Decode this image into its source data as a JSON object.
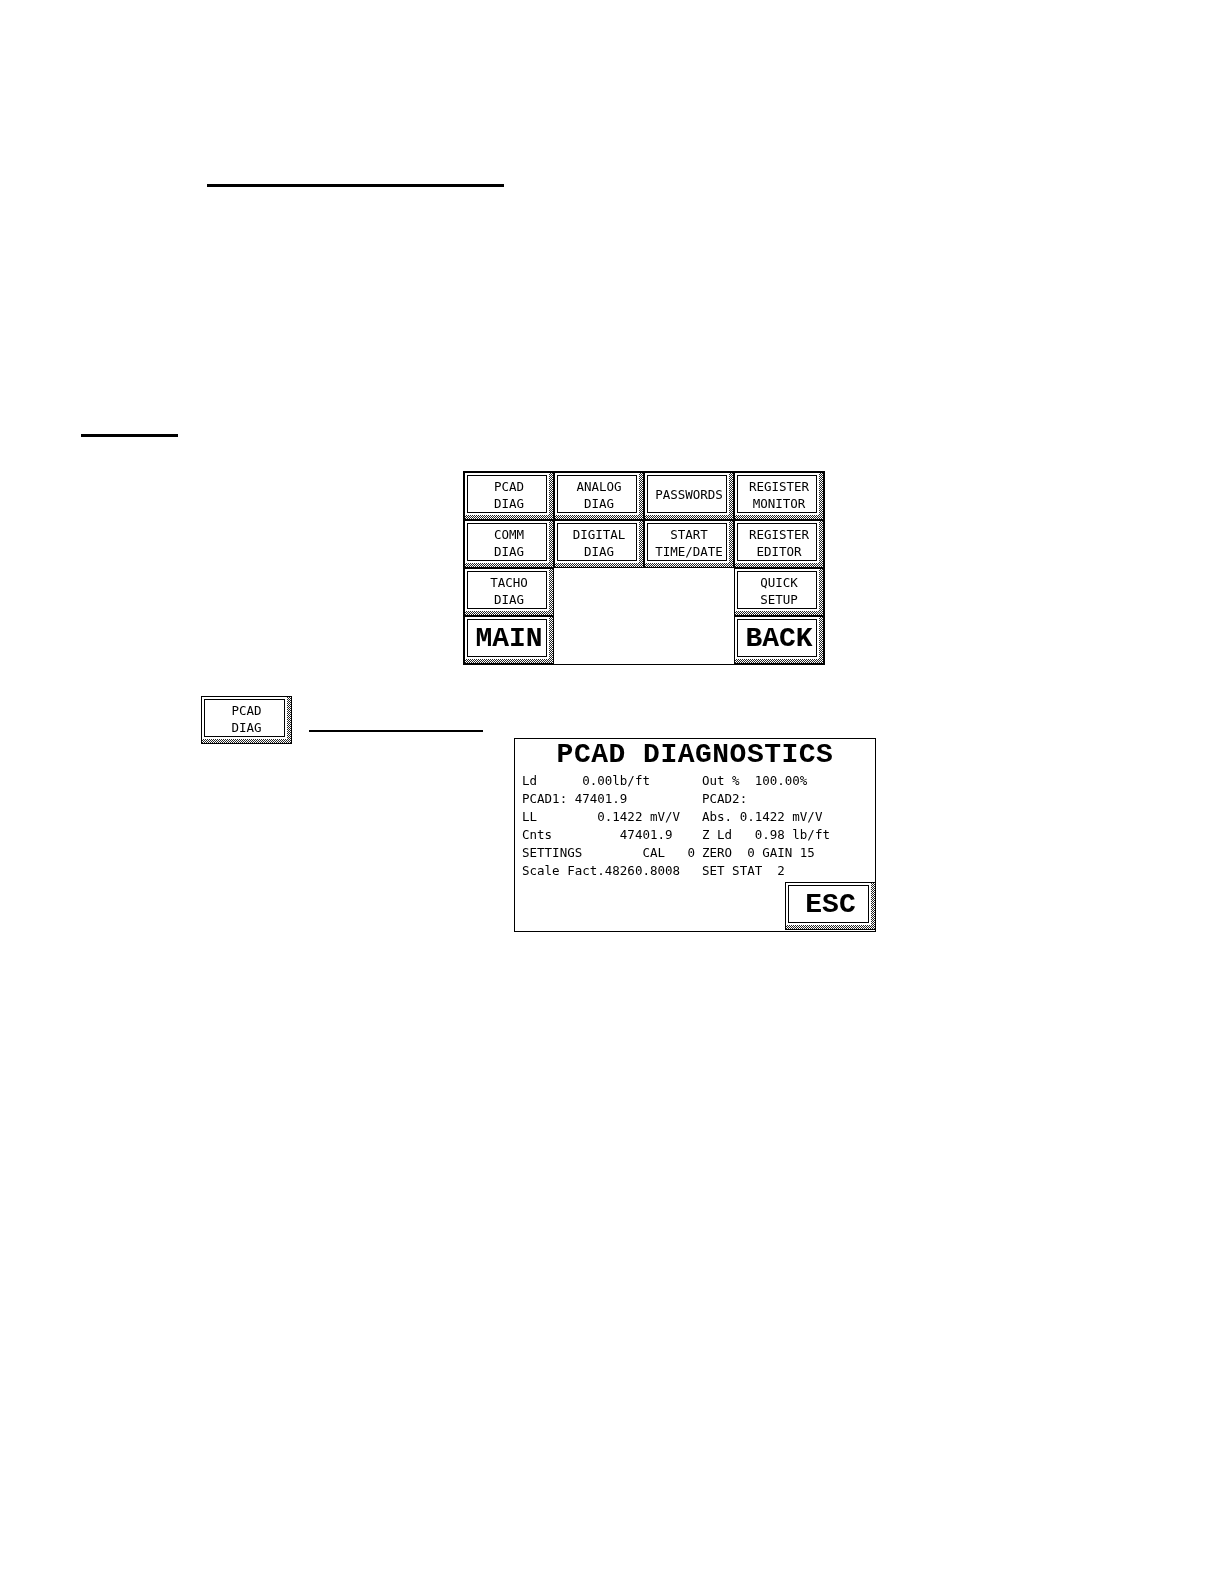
{
  "menu": {
    "top_rows": [
      [
        {
          "kind": "text",
          "label": "PCAD\nDIAG"
        },
        {
          "kind": "text",
          "label": "ANALOG\nDIAG"
        },
        {
          "kind": "text",
          "label": "PASSWORDS"
        },
        {
          "kind": "text",
          "label": "REGISTER\nMONITOR"
        }
      ],
      [
        {
          "kind": "text",
          "label": "COMM\nDIAG"
        },
        {
          "kind": "text",
          "label": "DIGITAL\nDIAG"
        },
        {
          "kind": "text",
          "label": "START\nTIME/DATE"
        },
        {
          "kind": "text",
          "label": "REGISTER\nEDITOR"
        }
      ]
    ],
    "left_column": [
      {
        "kind": "text",
        "label": "TACHO\nDIAG"
      },
      {
        "kind": "large",
        "label": "MAIN"
      }
    ],
    "right_column": [
      {
        "kind": "text",
        "label": "QUICK\nSETUP"
      },
      {
        "kind": "large",
        "label": "BACK"
      }
    ]
  },
  "pcad_button": {
    "kind": "text",
    "label": "PCAD\nDIAG"
  },
  "diagnostics": {
    "title": "PCAD DIAGNOSTICS",
    "rows": [
      {
        "left": "Ld      0.00lb/ft",
        "right": "Out %  100.00%"
      },
      {
        "left": "PCAD1: 47401.9",
        "right": "PCAD2:"
      },
      {
        "left": "LL        0.1422 mV/V",
        "right": "Abs. 0.1422 mV/V"
      },
      {
        "left": "Cnts         47401.9",
        "right": "Z Ld   0.98 lb/ft"
      },
      {
        "left": "SETTINGS        CAL   0",
        "right": "ZERO  0 GAIN 15"
      },
      {
        "left": "Scale Fact.48260.8008",
        "right": "SET STAT  2"
      }
    ],
    "esc_button": {
      "kind": "large",
      "label": "ESC"
    }
  }
}
